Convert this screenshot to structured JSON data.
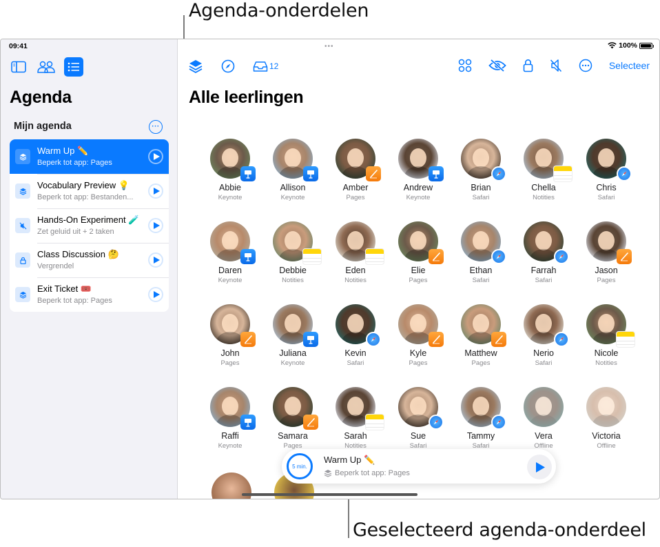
{
  "callouts": {
    "top": "Agenda-onderdelen",
    "bottom": "Geselecteerd agenda-onderdeel"
  },
  "status_bar": {
    "time": "09:41",
    "battery": "100%",
    "wifi_icon": "wifi-icon",
    "battery_icon": "battery-full-icon"
  },
  "sidebar": {
    "toolbar": [
      {
        "name": "sidebar-toggle",
        "icon": "sidebar-icon",
        "active": false
      },
      {
        "name": "students",
        "icon": "people-icon",
        "active": false
      },
      {
        "name": "agenda",
        "icon": "list-icon",
        "active": true
      }
    ],
    "title": "Agenda",
    "section_title": "Mijn agenda",
    "section_more_icon": "ellipsis-circle-icon",
    "items": [
      {
        "title": "Warm Up ✏️",
        "subtitle": "Beperk tot app: Pages",
        "icon": "layers-icon",
        "selected": true
      },
      {
        "title": "Vocabulary Preview 💡",
        "subtitle": "Beperk tot app: Bestanden...",
        "icon": "layers-icon",
        "selected": false
      },
      {
        "title": "Hands-On Experiment 🧪",
        "subtitle": "Zet geluid uit + 2 taken",
        "icon": "speaker-mute-icon",
        "selected": false
      },
      {
        "title": "Class Discussion 🤔",
        "subtitle": "Vergrendel",
        "icon": "lock-icon",
        "selected": false
      },
      {
        "title": "Exit Ticket 🎟️",
        "subtitle": "Beperk tot app: Pages",
        "icon": "layers-icon",
        "selected": false
      }
    ]
  },
  "main": {
    "title": "Alle leerlingen",
    "toolbar_left": {
      "apps_icon": "layers-icon",
      "navigate_icon": "compass-icon",
      "inbox_icon": "tray-icon",
      "inbox_count": "12"
    },
    "toolbar_right": {
      "groups_icon": "grid-circles-icon",
      "hide_icon": "eye-slash-icon",
      "lock_icon": "lock-icon",
      "mute_icon": "speaker-mute-icon",
      "more_icon": "ellipsis-circle-icon",
      "select_label": "Selecteer"
    },
    "students": [
      {
        "name": "Abbie",
        "app": "Keynote"
      },
      {
        "name": "Allison",
        "app": "Keynote"
      },
      {
        "name": "Amber",
        "app": "Pages"
      },
      {
        "name": "Andrew",
        "app": "Keynote"
      },
      {
        "name": "Brian",
        "app": "Safari"
      },
      {
        "name": "Chella",
        "app": "Notities"
      },
      {
        "name": "Chris",
        "app": "Safari"
      },
      {
        "name": "Daren",
        "app": "Keynote"
      },
      {
        "name": "Debbie",
        "app": "Notities"
      },
      {
        "name": "Eden",
        "app": "Notities"
      },
      {
        "name": "Elie",
        "app": "Pages"
      },
      {
        "name": "Ethan",
        "app": "Safari"
      },
      {
        "name": "Farrah",
        "app": "Safari"
      },
      {
        "name": "Jason",
        "app": "Pages"
      },
      {
        "name": "John",
        "app": "Pages"
      },
      {
        "name": "Juliana",
        "app": "Keynote"
      },
      {
        "name": "Kevin",
        "app": "Safari"
      },
      {
        "name": "Kyle",
        "app": "Pages"
      },
      {
        "name": "Matthew",
        "app": "Pages"
      },
      {
        "name": "Nerio",
        "app": "Safari"
      },
      {
        "name": "Nicole",
        "app": "Notities"
      },
      {
        "name": "Raffi",
        "app": "Keynote"
      },
      {
        "name": "Samara",
        "app": "Pages"
      },
      {
        "name": "Sarah",
        "app": "Notities"
      },
      {
        "name": "Sue",
        "app": "Safari"
      },
      {
        "name": "Tammy",
        "app": "Safari"
      },
      {
        "name": "Vera",
        "app": "Offline"
      },
      {
        "name": "Victoria",
        "app": "Offline"
      }
    ],
    "now_playing": {
      "timer": "5 min.",
      "title": "Warm Up ✏️",
      "subtitle": "Beperk tot app: Pages",
      "subtitle_icon": "layers-icon",
      "play_icon": "play-icon"
    }
  },
  "colors": {
    "accent": "#0a7aff",
    "sidebar_bg": "#f2f2f7",
    "keynote": "#1a82f5",
    "pages": "#f7870f",
    "notes": "#ffd60a"
  }
}
